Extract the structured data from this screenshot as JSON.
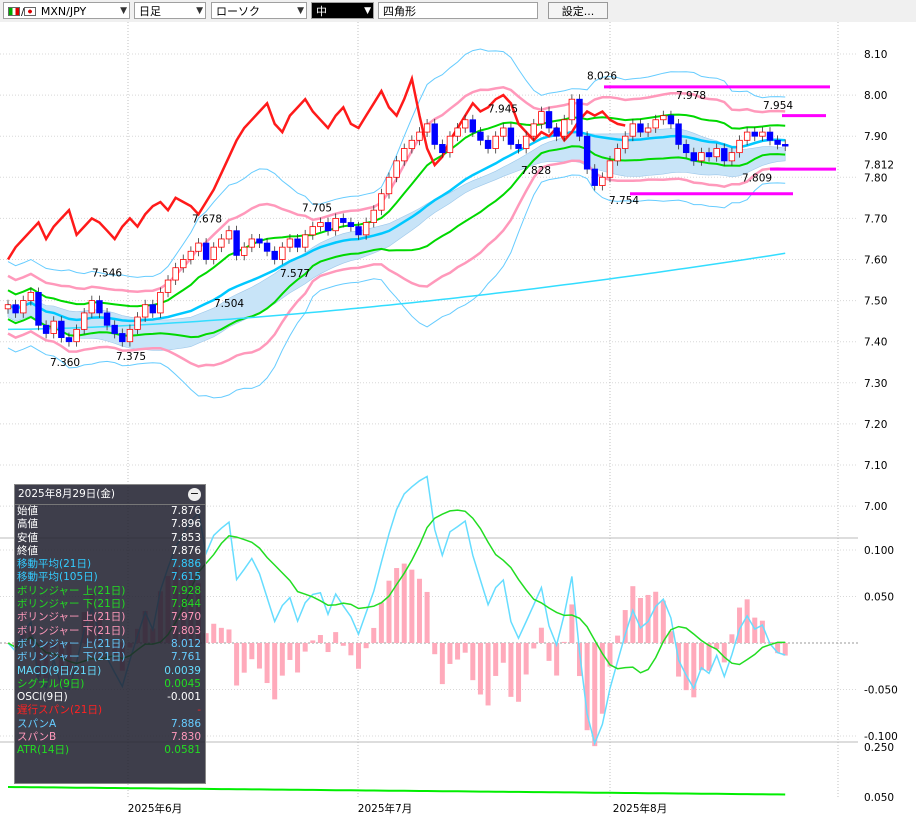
{
  "toolbar": {
    "symbol": "MXN/JPY",
    "period": "日足",
    "chart_type": "ローソク",
    "line_width": "中",
    "shape": "四角形",
    "settings_label": "設定..."
  },
  "colors": {
    "up_candle": "#ff0000",
    "down_candle": "#0000ff",
    "ma21": "#00c8ff",
    "ma105": "#33ddff",
    "bb1": "#00d800",
    "bb2": "#ff99bb",
    "bb3": "#66ccff",
    "conversion": "#ff1a1a",
    "cloud": "#c8e4f8",
    "magenta": "#ff00ff",
    "macd": "#66ddff",
    "signal": "#22dd22",
    "osci": "#ffaabb",
    "atr": "#00ee00"
  },
  "legend": {
    "date": "2025年8月29日(金)",
    "rows": [
      {
        "label": "始値",
        "value": "7.876",
        "color": "#ffffff"
      },
      {
        "label": "高値",
        "value": "7.896",
        "color": "#ffffff"
      },
      {
        "label": "安値",
        "value": "7.853",
        "color": "#ffffff"
      },
      {
        "label": "終値",
        "value": "7.876",
        "color": "#ffffff"
      },
      {
        "label": "移動平均(21日)",
        "value": "7.886",
        "color": "#33ccff"
      },
      {
        "label": "移動平均(105日)",
        "value": "7.615",
        "color": "#33ccff"
      },
      {
        "label": "ボリンジャー 上(21日)",
        "value": "7.928",
        "color": "#22dd22"
      },
      {
        "label": "ボリンジャー 下(21日)",
        "value": "7.844",
        "color": "#22dd22"
      },
      {
        "label": "ボリンジャー 上(21日)",
        "value": "7.970",
        "color": "#ff99bb"
      },
      {
        "label": "ボリンジャー 下(21日)",
        "value": "7.803",
        "color": "#ff99bb"
      },
      {
        "label": "ボリンジャー 上(21日)",
        "value": "8.012",
        "color": "#66ccff"
      },
      {
        "label": "ボリンジャー 下(21日)",
        "value": "7.761",
        "color": "#66ccff"
      },
      {
        "label": "MACD(9日/21日)",
        "value": "0.0039",
        "color": "#66ddff"
      },
      {
        "label": "シグナル(9日)",
        "value": "0.0045",
        "color": "#22dd22"
      },
      {
        "label": "OSCI(9日)",
        "value": "-0.001",
        "color": "#ffffff"
      },
      {
        "label": "遅行スパン(21日)",
        "value": "-",
        "color": "#ff2222"
      },
      {
        "label": "スパンA",
        "value": "7.886",
        "color": "#66ccff"
      },
      {
        "label": "スパンB",
        "value": "7.830",
        "color": "#ff99bb"
      },
      {
        "label": "ATR(14日)",
        "value": "0.0581",
        "color": "#22dd22"
      }
    ]
  },
  "chart_data": [
    {
      "type": "candlestick",
      "x_labels": [
        "2025年6月",
        "2025年7月",
        "2025年8月"
      ],
      "ylim": [
        7.0,
        8.15
      ],
      "y_ticks": [
        "8.10",
        "8.00",
        "7.90",
        "7.80",
        "7.70",
        "7.60",
        "7.50",
        "7.40",
        "7.30",
        "7.20",
        "7.10",
        "7.00"
      ],
      "current_price_label": "7.812",
      "annotations": [
        {
          "text": "7.360",
          "y": 7.36
        },
        {
          "text": "7.546",
          "y": 7.546
        },
        {
          "text": "7.375",
          "y": 7.375
        },
        {
          "text": "7.678",
          "y": 7.678
        },
        {
          "text": "7.504",
          "y": 7.504
        },
        {
          "text": "7.705",
          "y": 7.705
        },
        {
          "text": "7.577",
          "y": 7.577
        },
        {
          "text": "7.945",
          "y": 7.945
        },
        {
          "text": "7.828",
          "y": 7.828
        },
        {
          "text": "8.026",
          "y": 8.026
        },
        {
          "text": "7.754",
          "y": 7.754
        },
        {
          "text": "7.978",
          "y": 7.978
        },
        {
          "text": "7.809",
          "y": 7.809
        },
        {
          "text": "7.954",
          "y": 7.954
        }
      ],
      "close": [
        7.49,
        7.47,
        7.5,
        7.52,
        7.44,
        7.42,
        7.45,
        7.41,
        7.4,
        7.43,
        7.47,
        7.5,
        7.47,
        7.44,
        7.42,
        7.4,
        7.43,
        7.46,
        7.49,
        7.47,
        7.52,
        7.55,
        7.58,
        7.6,
        7.62,
        7.64,
        7.6,
        7.63,
        7.65,
        7.67,
        7.61,
        7.63,
        7.65,
        7.64,
        7.62,
        7.6,
        7.63,
        7.65,
        7.63,
        7.66,
        7.68,
        7.69,
        7.67,
        7.7,
        7.69,
        7.68,
        7.66,
        7.69,
        7.72,
        7.76,
        7.8,
        7.84,
        7.87,
        7.89,
        7.91,
        7.93,
        7.88,
        7.86,
        7.9,
        7.92,
        7.94,
        7.91,
        7.89,
        7.87,
        7.9,
        7.92,
        7.88,
        7.87,
        7.9,
        7.93,
        7.96,
        7.92,
        7.9,
        7.94,
        7.99,
        7.9,
        7.82,
        7.78,
        7.8,
        7.84,
        7.87,
        7.9,
        7.93,
        7.91,
        7.92,
        7.94,
        7.95,
        7.93,
        7.88,
        7.86,
        7.84,
        7.86,
        7.85,
        7.87,
        7.84,
        7.86,
        7.89,
        7.91,
        7.9,
        7.91,
        7.89,
        7.88,
        7.876
      ],
      "ma105": [
        7.43,
        7.44,
        7.6,
        7.615
      ],
      "bollinger": {
        "upper1": 7.928,
        "lower1": 7.844,
        "upper2": 7.97,
        "lower2": 7.803,
        "upper3": 8.012,
        "lower3": 7.761
      },
      "ma21_last": 7.886,
      "span_a_last": 7.886,
      "span_b_last": 7.83
    },
    {
      "type": "line",
      "name_series": [
        "MACD",
        "シグナル",
        "OSCI"
      ],
      "ylim": [
        -0.12,
        0.12
      ],
      "y_ticks": [
        "0.100",
        "0.050",
        "-0.050",
        "-0.100"
      ],
      "macd_last": 0.0039,
      "signal_last": 0.0045,
      "osci_last": -0.001
    },
    {
      "type": "line",
      "name_series": [
        "ATR"
      ],
      "y_ticks": [
        "0.250",
        "0.050"
      ],
      "atr_last": 0.0581
    }
  ]
}
